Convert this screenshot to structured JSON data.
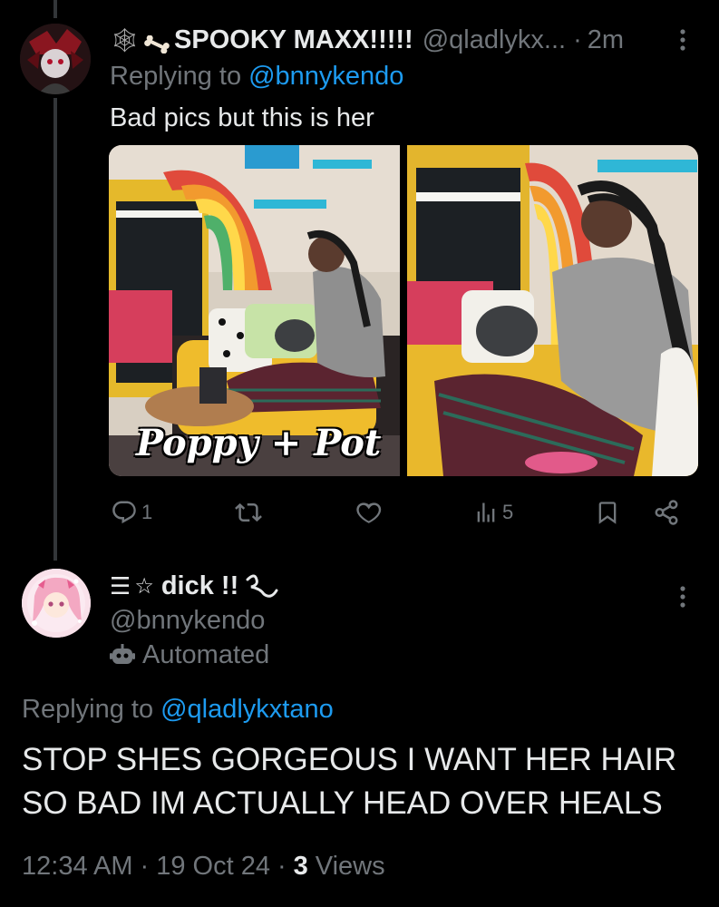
{
  "tweet1": {
    "display_name": "SPOOKY MAXX!!!!!",
    "handle": "@qladlykx...",
    "separator": "·",
    "time": "2m",
    "replying_prefix": "Replying to",
    "replying_handle": "@bnnykendo",
    "text": "Bad pics but this is her",
    "photo_caption": "Poppy + Pot",
    "actions": {
      "replies": "1",
      "views": "5"
    }
  },
  "tweet2": {
    "display_name": "dick !!",
    "handle": "@bnnykendo",
    "automated_label": "Automated",
    "replying_prefix": "Replying to",
    "replying_handle": "@qladlykxtano",
    "text_line1": "STOP SHES GORGEOUS I WANT HER HAIR",
    "text_line2": "SO BAD IM ACTUALLY HEAD OVER HEALS",
    "meta": {
      "time": "12:34 AM",
      "sep": "·",
      "date": "19 Oct 24",
      "views_count": "3",
      "views_label": "Views"
    }
  },
  "colors": {
    "background": "#000000",
    "text": "#e7e9ea",
    "muted": "#71767b",
    "link": "#1d9bf0",
    "thread_line": "#333639"
  }
}
